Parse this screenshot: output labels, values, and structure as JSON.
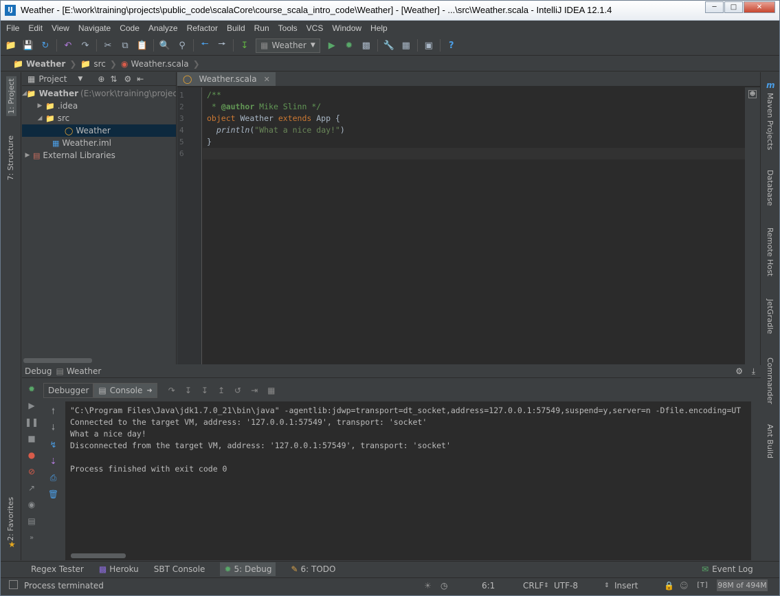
{
  "window": {
    "title": "Weather - [E:\\work\\training\\projects\\public_code\\scalaCore\\course_scala_intro_code\\Weather] - [Weather] - ...\\src\\Weather.scala - IntelliJ IDEA 12.1.4",
    "app_icon": "IJ"
  },
  "menu": [
    "File",
    "Edit",
    "View",
    "Navigate",
    "Code",
    "Analyze",
    "Refactor",
    "Build",
    "Run",
    "Tools",
    "VCS",
    "Window",
    "Help"
  ],
  "toolbar": {
    "run_config": "Weather"
  },
  "breadcrumbs": [
    "Weather",
    "src",
    "Weather.scala"
  ],
  "left_tool_tabs": [
    "1: Project",
    "7: Structure",
    "2: Favorites"
  ],
  "right_tool_tabs": [
    "Maven Projects",
    "Database",
    "Remote Host",
    "JetGradle",
    "Commander",
    "Ant Build"
  ],
  "project": {
    "view_label": "Project",
    "tree": [
      {
        "label": "Weather",
        "detail": "(E:\\work\\training\\projects\\p",
        "indent": 0,
        "expanded": true,
        "icon": "folder-icon"
      },
      {
        "label": ".idea",
        "indent": 1,
        "expanded": false,
        "icon": "folder-icon"
      },
      {
        "label": "src",
        "indent": 1,
        "expanded": true,
        "icon": "folder-icon"
      },
      {
        "label": "Weather",
        "indent": 3,
        "selected": true,
        "icon": "scala-object-icon"
      },
      {
        "label": "Weather.iml",
        "indent": 2,
        "icon": "iml-file-icon"
      },
      {
        "label": "External Libraries",
        "indent": 0,
        "expanded": false,
        "icon": "library-icon"
      }
    ]
  },
  "editor": {
    "tab_label": "Weather.scala",
    "line_numbers": [
      "1",
      "2",
      "3",
      "4",
      "5",
      "6"
    ],
    "code": {
      "l1": "/**",
      "l2a": " * ",
      "l2b": "@author",
      "l2c": " Mike Slinn */",
      "l3a": "object",
      "l3b": " Weather ",
      "l3c": "extends",
      "l3d": " App {",
      "l4a": "  ",
      "l4b": "println",
      "l4c": "(",
      "l4d": "\"What a nice day!\"",
      "l4e": ")",
      "l5": "}"
    }
  },
  "debug": {
    "header_label": "Debug",
    "session": "Weather",
    "tabs": [
      "Debugger",
      "Console"
    ],
    "console_lines": [
      "\"C:\\Program Files\\Java\\jdk1.7.0_21\\bin\\java\" -agentlib:jdwp=transport=dt_socket,address=127.0.0.1:57549,suspend=y,server=n -Dfile.encoding=UT",
      "Connected to the target VM, address: '127.0.0.1:57549', transport: 'socket'",
      "What a nice day!",
      "Disconnected from the target VM, address: '127.0.0.1:57549', transport: 'socket'",
      "",
      "Process finished with exit code 0"
    ]
  },
  "bottom_tabs": [
    {
      "label": "Regex Tester",
      "icon": ""
    },
    {
      "label": "Heroku",
      "icon": "heroku-icon"
    },
    {
      "label": "SBT Console",
      "icon": ""
    },
    {
      "label": "5: Debug",
      "icon": "debug-icon",
      "active": true
    },
    {
      "label": "6: TODO",
      "icon": "todo-icon"
    }
  ],
  "event_log": "Event Log",
  "status": {
    "message": "Process terminated",
    "position": "6:1",
    "line_sep": "CRLF",
    "encoding": "UTF-8",
    "mode": "Insert",
    "memory": "98M of 494M",
    "indicator": "[T]"
  },
  "colors": {
    "background": "#3c3f41",
    "editor_bg": "#2b2b2b",
    "keyword": "#cc7832",
    "string": "#6a8759",
    "comment": "#629755",
    "selection": "#0d293e"
  }
}
